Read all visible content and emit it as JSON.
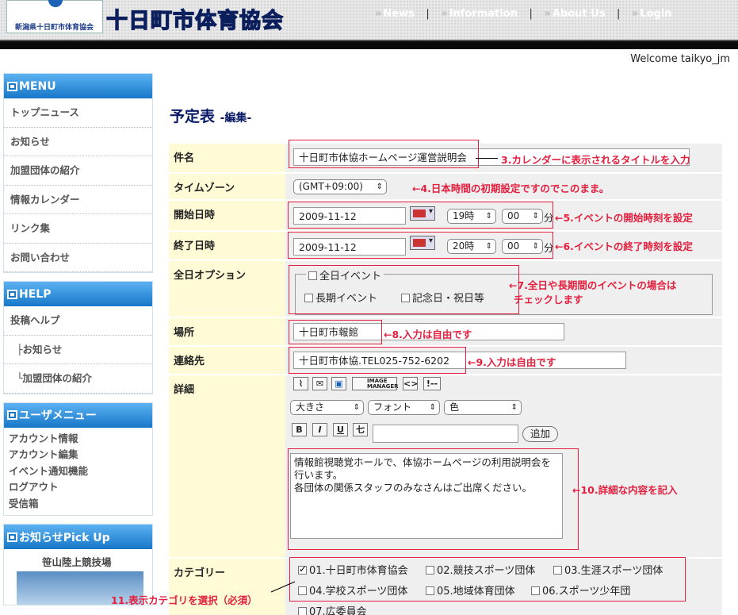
{
  "header": {
    "logo_small": "新潟県十日町市体育協会",
    "logo_title": "十日町市体育協会",
    "nav": [
      "News",
      "Information",
      "About Us",
      "Login"
    ]
  },
  "welcome": "Welcome taikyo_jm",
  "sidebar": {
    "menu_title": "MENU",
    "menu_items": [
      "トップニュース",
      "お知らせ",
      "加盟団体の紹介",
      "情報カレンダー",
      "リンク集",
      "お問い合わせ"
    ],
    "help_title": "HELP",
    "help_items": [
      "投稿ヘルプ",
      "├お知らせ",
      "└加盟団体の紹介"
    ],
    "user_title": "ユーザメニュー",
    "user_items": [
      "アカウント情報",
      "アカウント編集",
      "イベント通知機能",
      "ログアウト",
      "受信箱"
    ],
    "pickup_title": "お知らせPick Up",
    "pickup_caption": "笹山陸上競技場"
  },
  "page": {
    "title": "予定表",
    "subtitle": "-編集-"
  },
  "form": {
    "subject": {
      "label": "件名",
      "value": "十日町市体協ホームページ運営説明会",
      "note": "3.カレンダーに表示されるタイトルを入力"
    },
    "timezone": {
      "label": "タイムゾーン",
      "value": "(GMT+09:00)",
      "note": "←4.日本時間の初期設定ですのでこのまま。"
    },
    "start": {
      "label": "開始日時",
      "date": "2009-11-12",
      "hour": "19時",
      "minute": "00",
      "unit": "分",
      "note": "←5.イベントの開始時刻を設定"
    },
    "end": {
      "label": "終了日時",
      "date": "2009-11-12",
      "hour": "20時",
      "minute": "00",
      "unit": "分",
      "note": "←6.イベントの終了時刻を設定"
    },
    "allday": {
      "label": "全日オプション",
      "legend": "全日イベント",
      "long": "長期イベント",
      "holiday": "記念日・祝日等",
      "note1": "←7.全日や長期間のイベントの場合は",
      "note2": "チェックします"
    },
    "place": {
      "label": "場所",
      "value": "十日町市報館",
      "note": "←8.入力は自由です"
    },
    "contact": {
      "label": "連絡先",
      "value": "十日町市体協.TEL025-752-6202",
      "note": "←9.入力は自由です"
    },
    "detail": {
      "label": "詳細",
      "img_manager": [
        "IMAGE",
        "MANAGER"
      ],
      "code_btn": "<>",
      "comment_btn": "!--",
      "size_select": "大きさ",
      "font_select": "フォント",
      "color_select": "色",
      "bold": "B",
      "italic": "I",
      "underline": "U",
      "strike": "七",
      "add_button": "追加",
      "text_lines": [
        "情報館視聴覚ホールで、体協ホームページの利用説明会を",
        "行います。",
        "各団体の関係スタッフのみなさんはご出席ください。"
      ],
      "note": "←10.詳細な内容を記入"
    },
    "category": {
      "label": "カテゴリー",
      "items": [
        "01.十日町市体育協会",
        "02.競技スポーツ団体",
        "03.生涯スポーツ団体",
        "04.学校スポーツ団体",
        "05.地域体育団体",
        "06.スポーツ少年団",
        "07.広委員会"
      ],
      "note": "11.表示カテゴリを選択（必須）"
    }
  }
}
